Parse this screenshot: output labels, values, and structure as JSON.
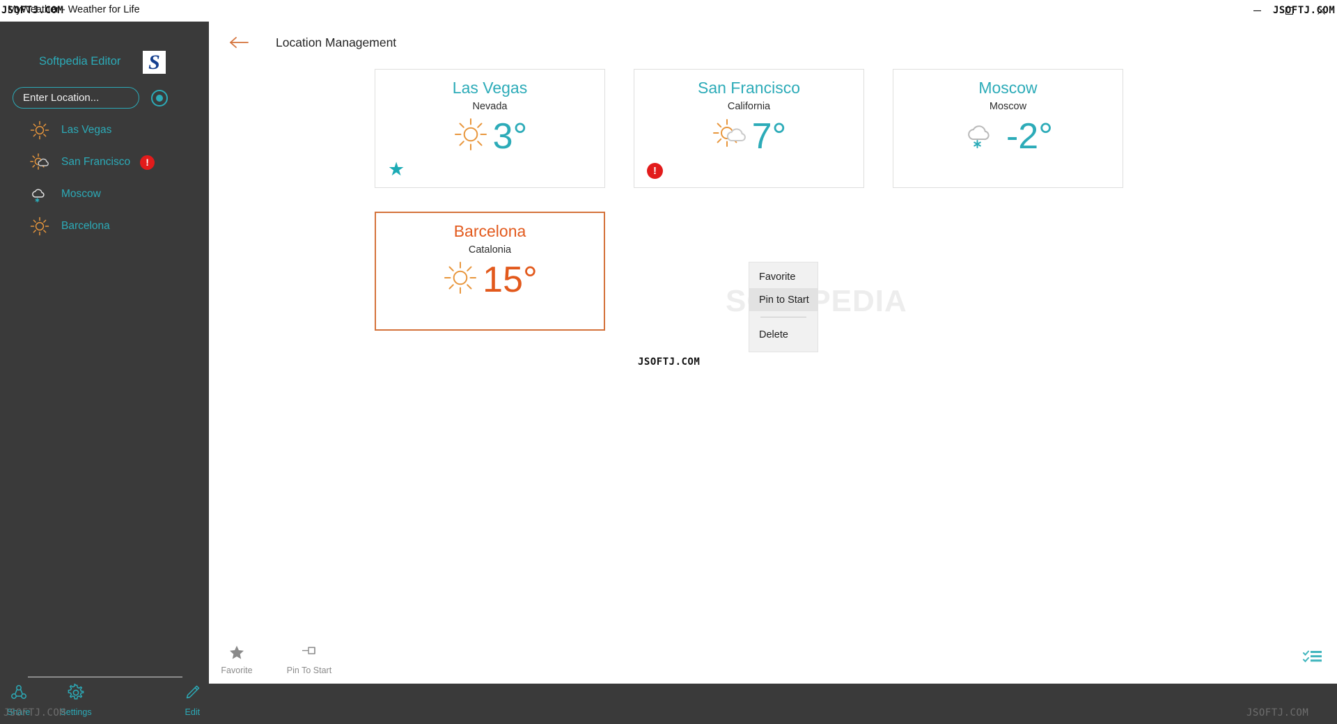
{
  "window": {
    "title": "MyWeather - Weather for Life",
    "controls": [
      {
        "name": "minimize",
        "glyph": "—"
      },
      {
        "name": "maximize",
        "glyph": "☐"
      },
      {
        "name": "close",
        "glyph": "✕"
      }
    ]
  },
  "watermarks": {
    "top_left": "JSOFTJ.COM",
    "top_right": "JSOFTJ.COM",
    "center": "JSOFTJ.COM",
    "bottom_left": "JSOFTJ.COM",
    "bottom_right": "JSOFTJ.COM",
    "behind_menu": "SOFTPEDIA"
  },
  "sidebar": {
    "editor_label": "Softpedia Editor",
    "logo_letter": "S",
    "search": {
      "placeholder": "Enter Location...",
      "value": ""
    },
    "locate_button": "locate-icon",
    "items": [
      {
        "label": "Las Vegas",
        "icon": "sun-icon",
        "alert": false,
        "alert_glyph": "!"
      },
      {
        "label": "San Francisco",
        "icon": "sun-cloud-icon",
        "alert": true,
        "alert_glyph": "!"
      },
      {
        "label": "Moscow",
        "icon": "cloud-snow-icon",
        "alert": false,
        "alert_glyph": "!"
      },
      {
        "label": "Barcelona",
        "icon": "sun-icon",
        "alert": false,
        "alert_glyph": "!"
      }
    ],
    "nav": [
      {
        "label": "Share",
        "icon": "share-icon"
      },
      {
        "label": "Settings",
        "icon": "gear-icon"
      },
      {
        "label": "Edit",
        "icon": "pencil-icon"
      }
    ]
  },
  "main": {
    "back_label": "back-arrow",
    "page_title": "Location Management",
    "cards": [
      {
        "city": "Las Vegas",
        "region": "Nevada",
        "temperature": "3°",
        "icon": "sun-icon",
        "selected": false,
        "corner": "favorite-star",
        "corner_glyph": "★"
      },
      {
        "city": "San Francisco",
        "region": "California",
        "temperature": "7°",
        "icon": "sun-cloud-icon",
        "selected": false,
        "corner": "alert-badge",
        "corner_glyph": "!"
      },
      {
        "city": "Moscow",
        "region": "Moscow",
        "temperature": "-2°",
        "icon": "cloud-snow-icon",
        "selected": false,
        "corner": "none",
        "corner_glyph": ""
      },
      {
        "city": "Barcelona",
        "region": "Catalonia",
        "temperature": "15°",
        "icon": "sun-icon",
        "selected": true,
        "corner": "none",
        "corner_glyph": ""
      }
    ]
  },
  "context_menu": {
    "items": [
      {
        "label": "Favorite",
        "highlighted": false
      },
      {
        "label": "Pin to Start",
        "highlighted": true
      },
      {
        "label": "Delete",
        "highlighted": false
      }
    ]
  },
  "appbar": {
    "items": [
      {
        "label": "Favorite",
        "icon": "star-icon"
      },
      {
        "label": "Pin To Start",
        "icon": "pin-icon"
      }
    ],
    "select_icon": "select-all-icon"
  },
  "colors": {
    "teal": "#2cabb8",
    "orange": "#e2591c",
    "selected_border": "#d4723a",
    "sidebar_bg": "#3a3a3a",
    "alert_red": "#e21b1b",
    "sun_orange": "#e8963c"
  }
}
